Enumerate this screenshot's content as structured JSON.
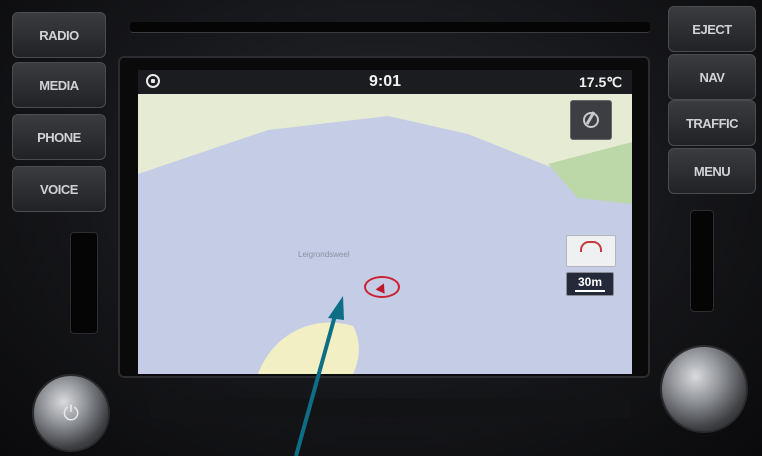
{
  "head_unit": {
    "left_buttons": [
      "RADIO",
      "MEDIA",
      "PHONE",
      "VOICE"
    ],
    "right_buttons": [
      "EJECT",
      "NAV",
      "TRAFFIC",
      "MENU"
    ],
    "knob_left_icon": "power-icon",
    "knob_right_icon": "tune-knob"
  },
  "screen": {
    "status": {
      "home_icon": "home-icon",
      "time": "9:01",
      "temperature": "17.5℃"
    },
    "map": {
      "street_label": "Leigrondsweel",
      "controls": {
        "overview_icon": "map-overview-icon",
        "weather_icon": "cloud-icon",
        "scale": "30m"
      },
      "colors": {
        "water": "#c5cde6",
        "land_light": "#e6ebd4",
        "park": "#bcd7a8",
        "beach": "#f2efc5",
        "marker": "#cc2030"
      }
    }
  },
  "annotation": {
    "arrow_color": "#0e6e86"
  }
}
